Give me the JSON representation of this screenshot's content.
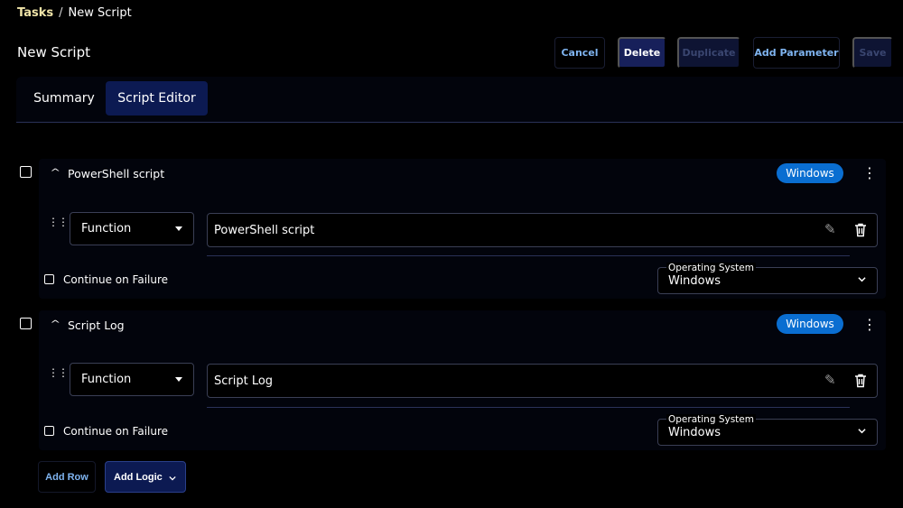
{
  "breadcrumb": {
    "root": "Tasks",
    "separator": "/",
    "current": "New Script"
  },
  "page": {
    "title": "New Script"
  },
  "toolbar": {
    "cancel_label": "Cancel",
    "delete_label": "Delete",
    "duplicate_label": "Duplicate",
    "add_parameter_label": "Add Parameter",
    "save_label": "Save"
  },
  "tabs": [
    {
      "label": "Summary",
      "active": false
    },
    {
      "label": "Script Editor",
      "active": true
    }
  ],
  "blocks": [
    {
      "title": "PowerShell script",
      "os_badge": "Windows",
      "type_select": "Function",
      "name_value": "PowerShell script",
      "continue_on_failure_label": "Continue on Failure",
      "os_select_label": "Operating System",
      "os_select_value": "Windows"
    },
    {
      "title": "Script Log",
      "os_badge": "Windows",
      "type_select": "Function",
      "name_value": "Script Log",
      "continue_on_failure_label": "Continue on Failure",
      "os_select_label": "Operating System",
      "os_select_value": "Windows"
    }
  ],
  "footer": {
    "add_row_label": "Add Row",
    "add_logic_label": "Add Logic"
  },
  "colors": {
    "accent_blue": "#0a6ed1",
    "link_blue": "#7fb4f0",
    "dark_navy": "#0c1a52",
    "breadcrumb_gold": "#f0e4a8"
  },
  "icons": [
    "chevron-up-icon",
    "kebab-menu-icon",
    "drag-handle-icon",
    "caret-down-icon",
    "pencil-icon",
    "trash-icon",
    "chevron-down-icon"
  ]
}
